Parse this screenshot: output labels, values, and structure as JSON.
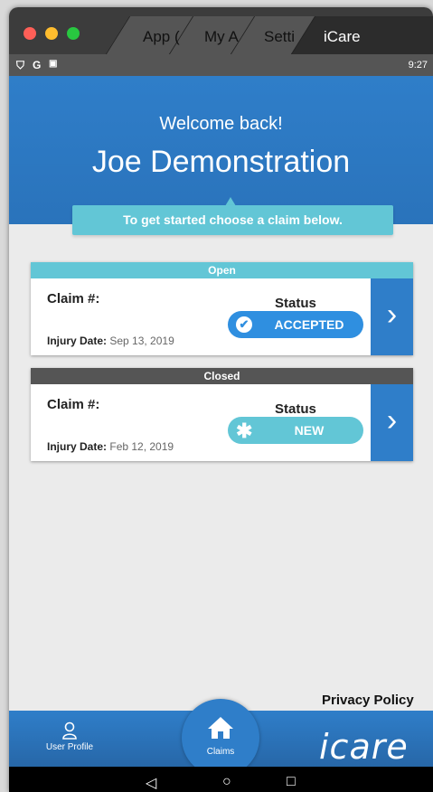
{
  "window": {
    "tabs": [
      {
        "label": "App (",
        "active": false
      },
      {
        "label": "My A",
        "active": false
      },
      {
        "label": "Setti",
        "active": false
      },
      {
        "label": "iCare",
        "active": true
      }
    ],
    "traffic_lights": [
      "#ff5f57",
      "#ffbd2e",
      "#28c840"
    ]
  },
  "statusbar": {
    "icons": [
      "shield-icon",
      "google-icon",
      "notification-icon"
    ],
    "time": "9:27"
  },
  "header": {
    "welcome": "Welcome back!",
    "username": "Joe Demonstration",
    "hint": "To get started choose a claim below."
  },
  "claims": [
    {
      "section": "Open",
      "section_color": "#62c6d6",
      "claim_label": "Claim #:",
      "claim_number": "",
      "status_label": "Status",
      "status": "ACCEPTED",
      "status_icon": "check-circle-icon",
      "status_color": "#2f8fe0",
      "injury_label": "Injury Date:",
      "injury_date": "Sep 13, 2019"
    },
    {
      "section": "Closed",
      "section_color": "#555555",
      "claim_label": "Claim #:",
      "claim_number": "",
      "status_label": "Status",
      "status": "NEW",
      "status_icon": "asterisk-icon",
      "status_color": "#62c6d6",
      "injury_label": "Injury Date:",
      "injury_date": "Feb 12, 2019"
    }
  ],
  "footer": {
    "privacy": "Privacy Policy",
    "nav": {
      "user_profile": "User Profile",
      "claims": "Claims"
    },
    "brand": "icare"
  },
  "colors": {
    "primary": "#2f7ec9",
    "accent": "#62c6d6",
    "background": "#ebebeb"
  }
}
